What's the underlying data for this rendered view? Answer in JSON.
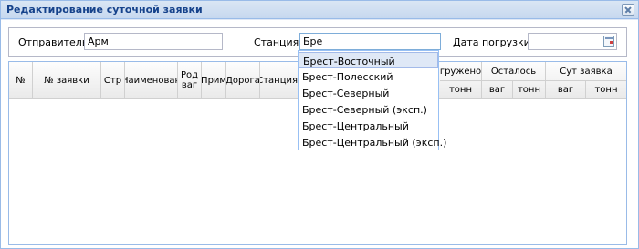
{
  "window": {
    "title": "Редактирование суточной заявки"
  },
  "filters": {
    "sender_label": "Отправитель:",
    "sender_value": "Арм",
    "station_label": "Станция:",
    "station_value": "Бре",
    "date_label": "Дата погрузки:",
    "date_value": ""
  },
  "grid": {
    "headers": {
      "num": "№",
      "order_num": "№ заявки",
      "country": "Стр",
      "name": "Наименован",
      "wagon_kind_1": "Род",
      "wagon_kind_2": "ваг",
      "note": "Прим",
      "road": "Дорога",
      "station": "Станция н",
      "loaded": "гружено",
      "loaded_tons": "тонн",
      "remaining": "Осталось",
      "remaining_wagons": "ваг",
      "remaining_tons": "тонн",
      "daily": "Сут заявка",
      "daily_wagons": "ваг",
      "daily_tons": "тонн"
    }
  },
  "dropdown": {
    "items": [
      "Брест-Восточный",
      "Брест-Полесский",
      "Брест-Северный",
      "Брест-Северный (эксп.)",
      "Брест-Центральный",
      "Брест-Центральный (эксп.)"
    ],
    "selected_index": 0
  }
}
